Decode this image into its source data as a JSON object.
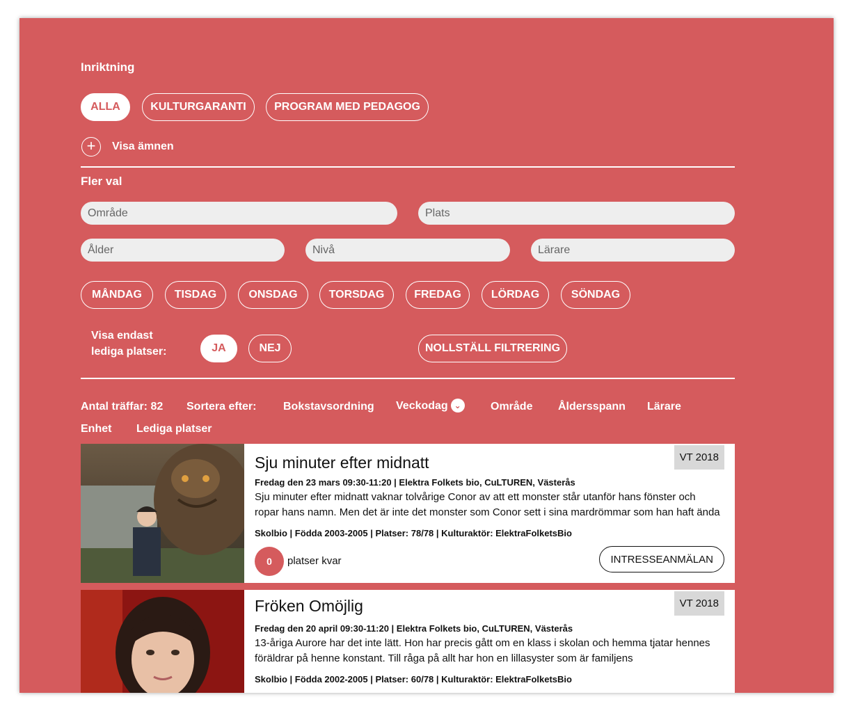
{
  "filters": {
    "inriktning_label": "Inriktning",
    "inriktning_options": [
      "ALLA",
      "KULTURGARANTI",
      "PROGRAM MED PEDAGOG"
    ],
    "show_subjects": "Visa ämnen",
    "more_label": "Fler val",
    "fields": {
      "omrade": "Område",
      "plats": "Plats",
      "alder": "Ålder",
      "niva": "Nivå",
      "larare": "Lärare"
    },
    "days": [
      "MÅNDAG",
      "TISDAG",
      "ONSDAG",
      "TORSDAG",
      "FREDAG",
      "LÖRDAG",
      "SÖNDAG"
    ],
    "only_free_line1": "Visa endast",
    "only_free_line2": "lediga platser:",
    "yes": "JA",
    "no": "NEJ",
    "reset": "NOLLSTÄLL FILTRERING"
  },
  "sort": {
    "hits": "Antal träffar: 82",
    "sort_by": "Sortera efter:",
    "options": [
      "Bokstavsordning",
      "Veckodag",
      "Område",
      "Åldersspann",
      "Lärare",
      "Enhet",
      "Lediga platser"
    ]
  },
  "colors": {
    "accent": "#d55b5d",
    "field_bg": "#eeeeee",
    "badge_bg": "#d8d8d8"
  },
  "events": [
    {
      "title": "Sju minuter efter midnatt",
      "badge": "VT 2018",
      "when": "Fredag den 23 mars 09:30-11:20 | Elektra Folkets bio, CuLTUREN, Västerås",
      "desc": "Sju minuter efter midnatt vaknar tolvårige Conor av att ett monster står utanför hans fönster och ropar hans namn. Men det är inte det monster som Conor sett i sina mardrömmar som han haft ända sedan hans mamma blev sjuk. Monstret",
      "info": "Skolbio | Födda 2003-2005 | Platser: 78/78 | Kulturaktör: ElektraFolketsBio",
      "count": "0",
      "count_label": "platser kvar",
      "button": "INTRESSEANMÄLAN"
    },
    {
      "title": "Fröken Omöjlig",
      "badge": "VT 2018",
      "when": "Fredag den 20 april 09:30-11:20 | Elektra Folkets bio, CuLTUREN, Västerås",
      "desc": "13-åriga Aurore har det inte lätt. Hon har precis gått om en klass i skolan och hemma tjatar hennes föräldrar på henne konstant. Till råga på allt har hon en lillasyster som är familjens",
      "info": "Skolbio | Födda 2002-2005 | Platser: 60/78 | Kulturaktör: ElektraFolketsBio"
    }
  ]
}
